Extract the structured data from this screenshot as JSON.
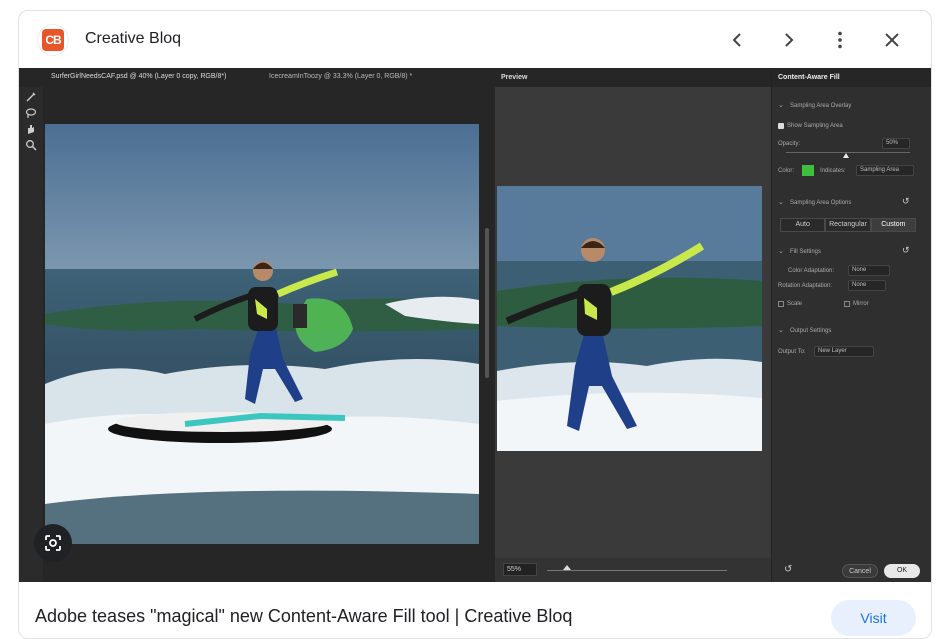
{
  "header": {
    "logo_text": "CB",
    "site_name": "Creative Bloq",
    "icons": [
      "chevron-left-icon",
      "chevron-right-icon",
      "more-vert-icon",
      "close-icon"
    ]
  },
  "photoshop": {
    "tabs": [
      "SurferGirlNeedsCAF.psd @ 40% (Layer 0 copy, RGB/8*)",
      "IcecreamInToozy @ 33.3% (Layer 0, RGB/8) *"
    ],
    "preview_title": "Preview",
    "zoom_value": "55%",
    "panel": {
      "title": "Content-Aware Fill",
      "sampling_overlay": "Sampling Area Overlay",
      "show_sampling_area": "Show Sampling Area",
      "opacity_label": "Opacity:",
      "opacity_value": "50%",
      "color_label": "Color:",
      "indicates_label": "Indicates:",
      "indicates_value": "Sampling Area",
      "sampling_options": "Sampling Area Options",
      "modes": [
        "Auto",
        "Rectangular",
        "Custom"
      ],
      "fill_settings": "Fill Settings",
      "color_adaptation_label": "Color Adaptation:",
      "color_adaptation_value": "None",
      "rotation_adaptation_label": "Rotation Adaptation:",
      "rotation_adaptation_value": "None",
      "scale_label": "Scale",
      "mirror_label": "Mirror",
      "output_settings": "Output Settings",
      "output_to_label": "Output To:",
      "output_to_value": "New Layer",
      "cancel_label": "Cancel",
      "ok_label": "OK",
      "overlay_color": "#3fbf3f"
    }
  },
  "caption": "Adobe teases \"magical\" new Content-Aware Fill tool | Creative Bloq",
  "visit_label": "Visit"
}
